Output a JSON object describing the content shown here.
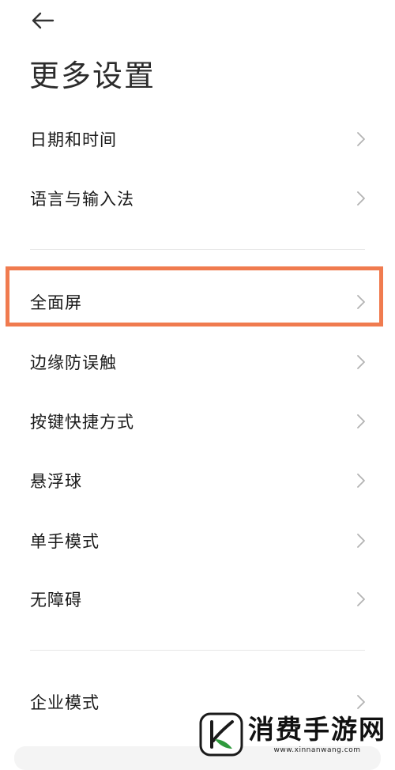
{
  "header": {
    "back_icon": "arrow-left-icon",
    "title": "更多设置"
  },
  "settings": {
    "group1": [
      {
        "label": "日期和时间",
        "icon": "chevron-right-icon"
      },
      {
        "label": "语言与输入法",
        "icon": "chevron-right-icon"
      }
    ],
    "group2": [
      {
        "label": "全面屏",
        "icon": "chevron-right-icon",
        "highlighted": true
      },
      {
        "label": "边缘防误触",
        "icon": "chevron-right-icon"
      },
      {
        "label": "按键快捷方式",
        "icon": "chevron-right-icon"
      },
      {
        "label": "悬浮球",
        "icon": "chevron-right-icon"
      },
      {
        "label": "单手模式",
        "icon": "chevron-right-icon"
      },
      {
        "label": "无障碍",
        "icon": "chevron-right-icon"
      }
    ],
    "group3": [
      {
        "label": "企业模式",
        "icon": "chevron-right-icon"
      }
    ]
  },
  "colors": {
    "highlight": "#f07b4f",
    "chevron": "#b3b3b3",
    "watermark_green": "#2e9a3c"
  },
  "watermark": {
    "name": "消费手游网",
    "url": "www.xinnanwang.com",
    "logo_icon": "k-logo-icon"
  }
}
